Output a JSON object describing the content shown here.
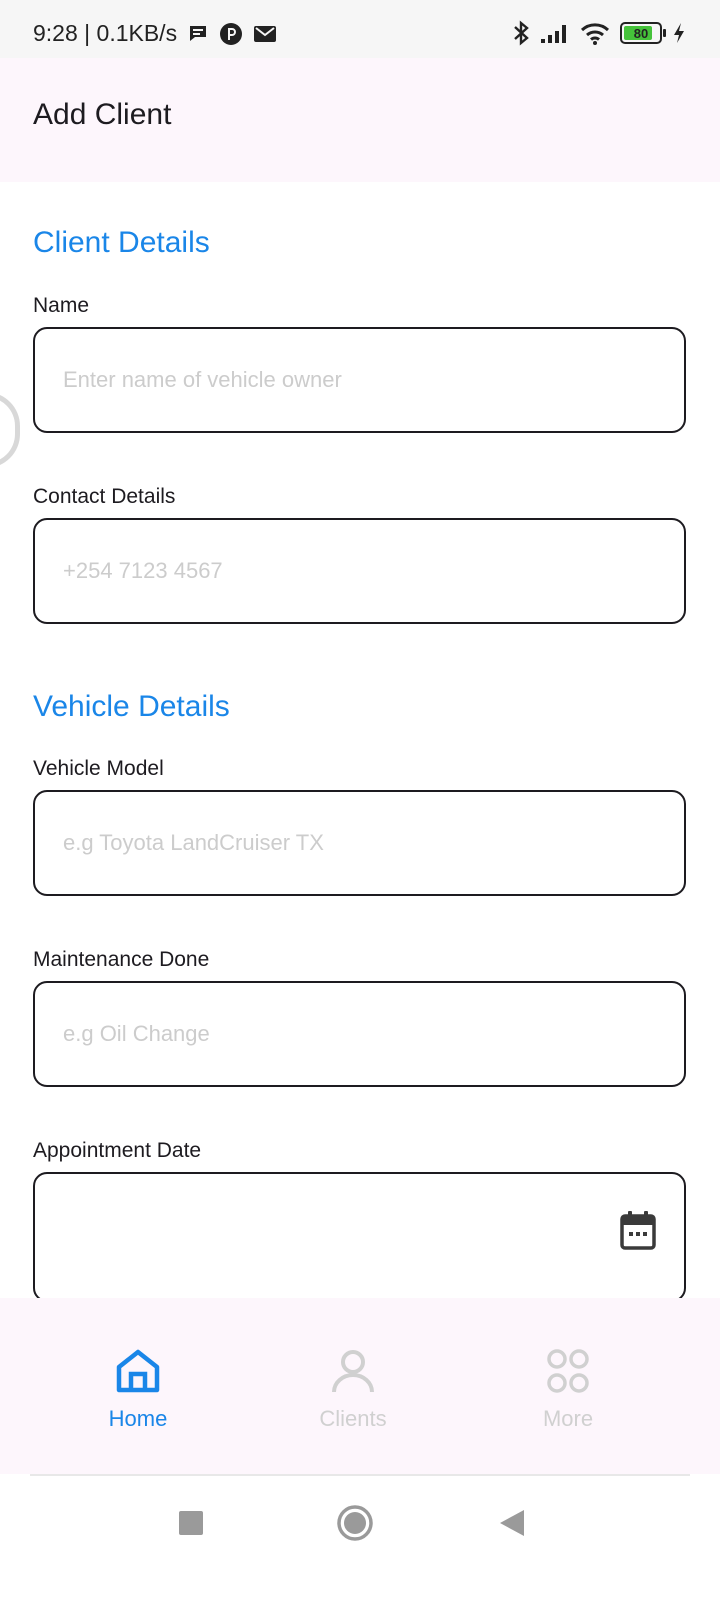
{
  "status_bar": {
    "time": "9:28",
    "network_speed": "0.1KB/s",
    "left_icons": [
      "chat-icon",
      "p-icon",
      "mail-icon"
    ],
    "right_icons": [
      "bluetooth-icon",
      "signal-icon",
      "wifi-icon",
      "battery-icon",
      "charging-icon"
    ],
    "battery_level": "80",
    "battery_fraction": 0.8
  },
  "header": {
    "title": "Add Client"
  },
  "form": {
    "client_section_title": "Client Details",
    "name": {
      "label": "Name",
      "value": "",
      "placeholder": "Enter name of vehicle owner"
    },
    "contact": {
      "label": "Contact Details",
      "value": "",
      "placeholder": "+254 7123 4567"
    },
    "vehicle_section_title": "Vehicle Details",
    "vehicle_model": {
      "label": "Vehicle Model",
      "value": "",
      "placeholder": "e.g Toyota LandCruiser TX"
    },
    "maintenance": {
      "label": "Maintenance Done",
      "value": "",
      "placeholder": "e.g Oil Change"
    },
    "appointment": {
      "label": "Appointment Date",
      "value": "",
      "icon": "calendar-icon"
    }
  },
  "bottom_nav": {
    "items": [
      {
        "label": "Home",
        "icon": "home-icon",
        "active": true
      },
      {
        "label": "Clients",
        "icon": "person-icon",
        "active": false
      },
      {
        "label": "More",
        "icon": "grid-icon",
        "active": false
      }
    ]
  },
  "system_nav": [
    "recents-button",
    "home-button",
    "back-button"
  ],
  "colors": {
    "accent": "#1a86e8",
    "header_bg": "#fdf6fc",
    "inactive": "#d0d0d0",
    "border": "#1d1b20"
  }
}
